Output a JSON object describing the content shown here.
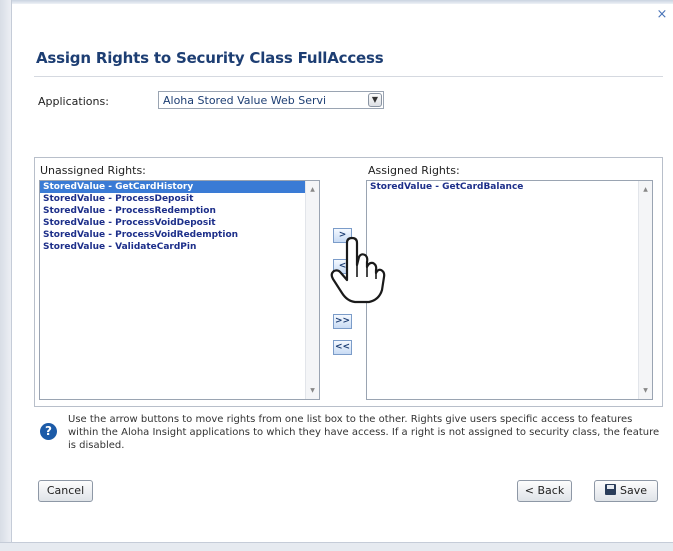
{
  "dialog": {
    "title": "Assign Rights to Security Class FullAccess",
    "close_glyph": "×"
  },
  "applications": {
    "label": "Applications:",
    "selected": "Aloha Stored Value Web Servi"
  },
  "unassigned": {
    "label": "Unassigned Rights:",
    "items": [
      "StoredValue - GetCardHistory",
      "StoredValue - ProcessDeposit",
      "StoredValue - ProcessRedemption",
      "StoredValue - ProcessVoidDeposit",
      "StoredValue - ProcessVoidRedemption",
      "StoredValue - ValidateCardPin"
    ],
    "selected_index": 0
  },
  "assigned": {
    "label": "Assigned Rights:",
    "items": [
      "StoredValue - GetCardBalance"
    ]
  },
  "move_buttons": {
    "add": ">",
    "remove": "<",
    "add_all": ">>",
    "remove_all": "<<"
  },
  "help": {
    "text": "Use the arrow buttons to move rights from one list box to the other. Rights give users specific access to features within the Aloha Insight applications to which they have access. If a right is not assigned to security class, the feature is disabled."
  },
  "footer": {
    "cancel": "Cancel",
    "back": "< Back",
    "save": "Save"
  },
  "icons": [
    "close-icon",
    "dropdown-arrow-icon",
    "help-icon",
    "save-icon",
    "hand-cursor-icon"
  ],
  "colors": {
    "title": "#1d3e73",
    "selection": "#3a7bd5",
    "list_text": "#1d2f8a",
    "help_icon": "#1c5ba8"
  }
}
